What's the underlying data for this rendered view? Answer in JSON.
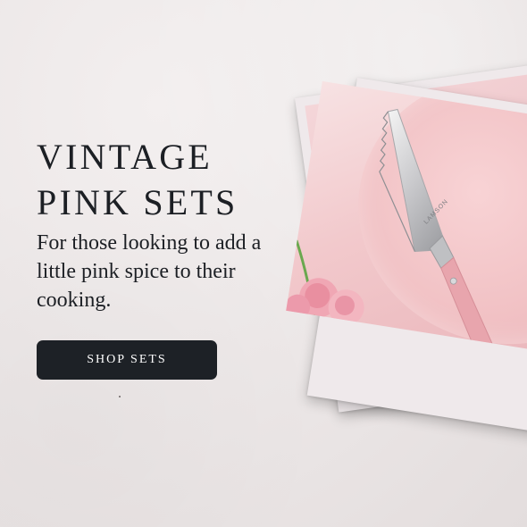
{
  "promo": {
    "headline_line1": "VINTAGE",
    "headline_line2": "PINK SETS",
    "subtext": "For those looking to add a little pink spice to their cooking.",
    "cta_label": "SHOP SETS"
  },
  "product_image": {
    "brand_engraving": "LAMSON",
    "icons": [
      "cake-server-icon",
      "rose-icon"
    ]
  },
  "colors": {
    "background": "#ebe6e6",
    "text": "#1c1f24",
    "button_bg": "#1d2126",
    "button_text": "#ffffff",
    "polaroid_frame": "#efe9eb",
    "photo_pink": "#f2c9cc",
    "handle_pink": "#e8a5ad"
  }
}
